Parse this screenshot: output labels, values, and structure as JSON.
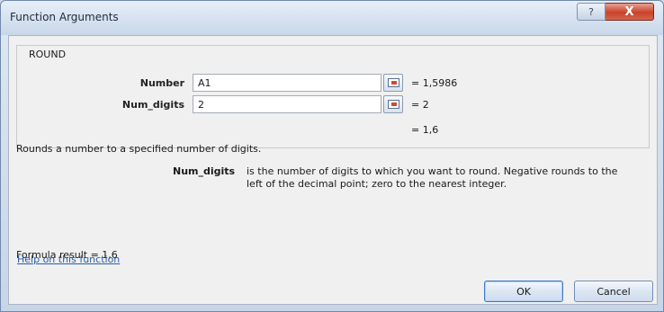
{
  "window": {
    "title": "Function Arguments",
    "help_glyph": "?",
    "close_glyph": "X"
  },
  "function": {
    "name": "ROUND"
  },
  "arguments": [
    {
      "label": "Number",
      "value": "A1",
      "result": "= 1,5986"
    },
    {
      "label": "Num_digits",
      "value": "2",
      "result": "= 2"
    }
  ],
  "overall_result": "= 1,6",
  "description": "Rounds a number to a specified number of digits.",
  "arg_help": {
    "name": "Num_digits",
    "text_line1": "is the number of digits to which you want to round. Negative rounds to the",
    "text_line2": "left of the decimal point; zero to the nearest integer."
  },
  "formula_result": "Formula result =  1,6",
  "help_link": "Help on this function",
  "buttons": {
    "ok": "OK",
    "cancel": "Cancel"
  }
}
